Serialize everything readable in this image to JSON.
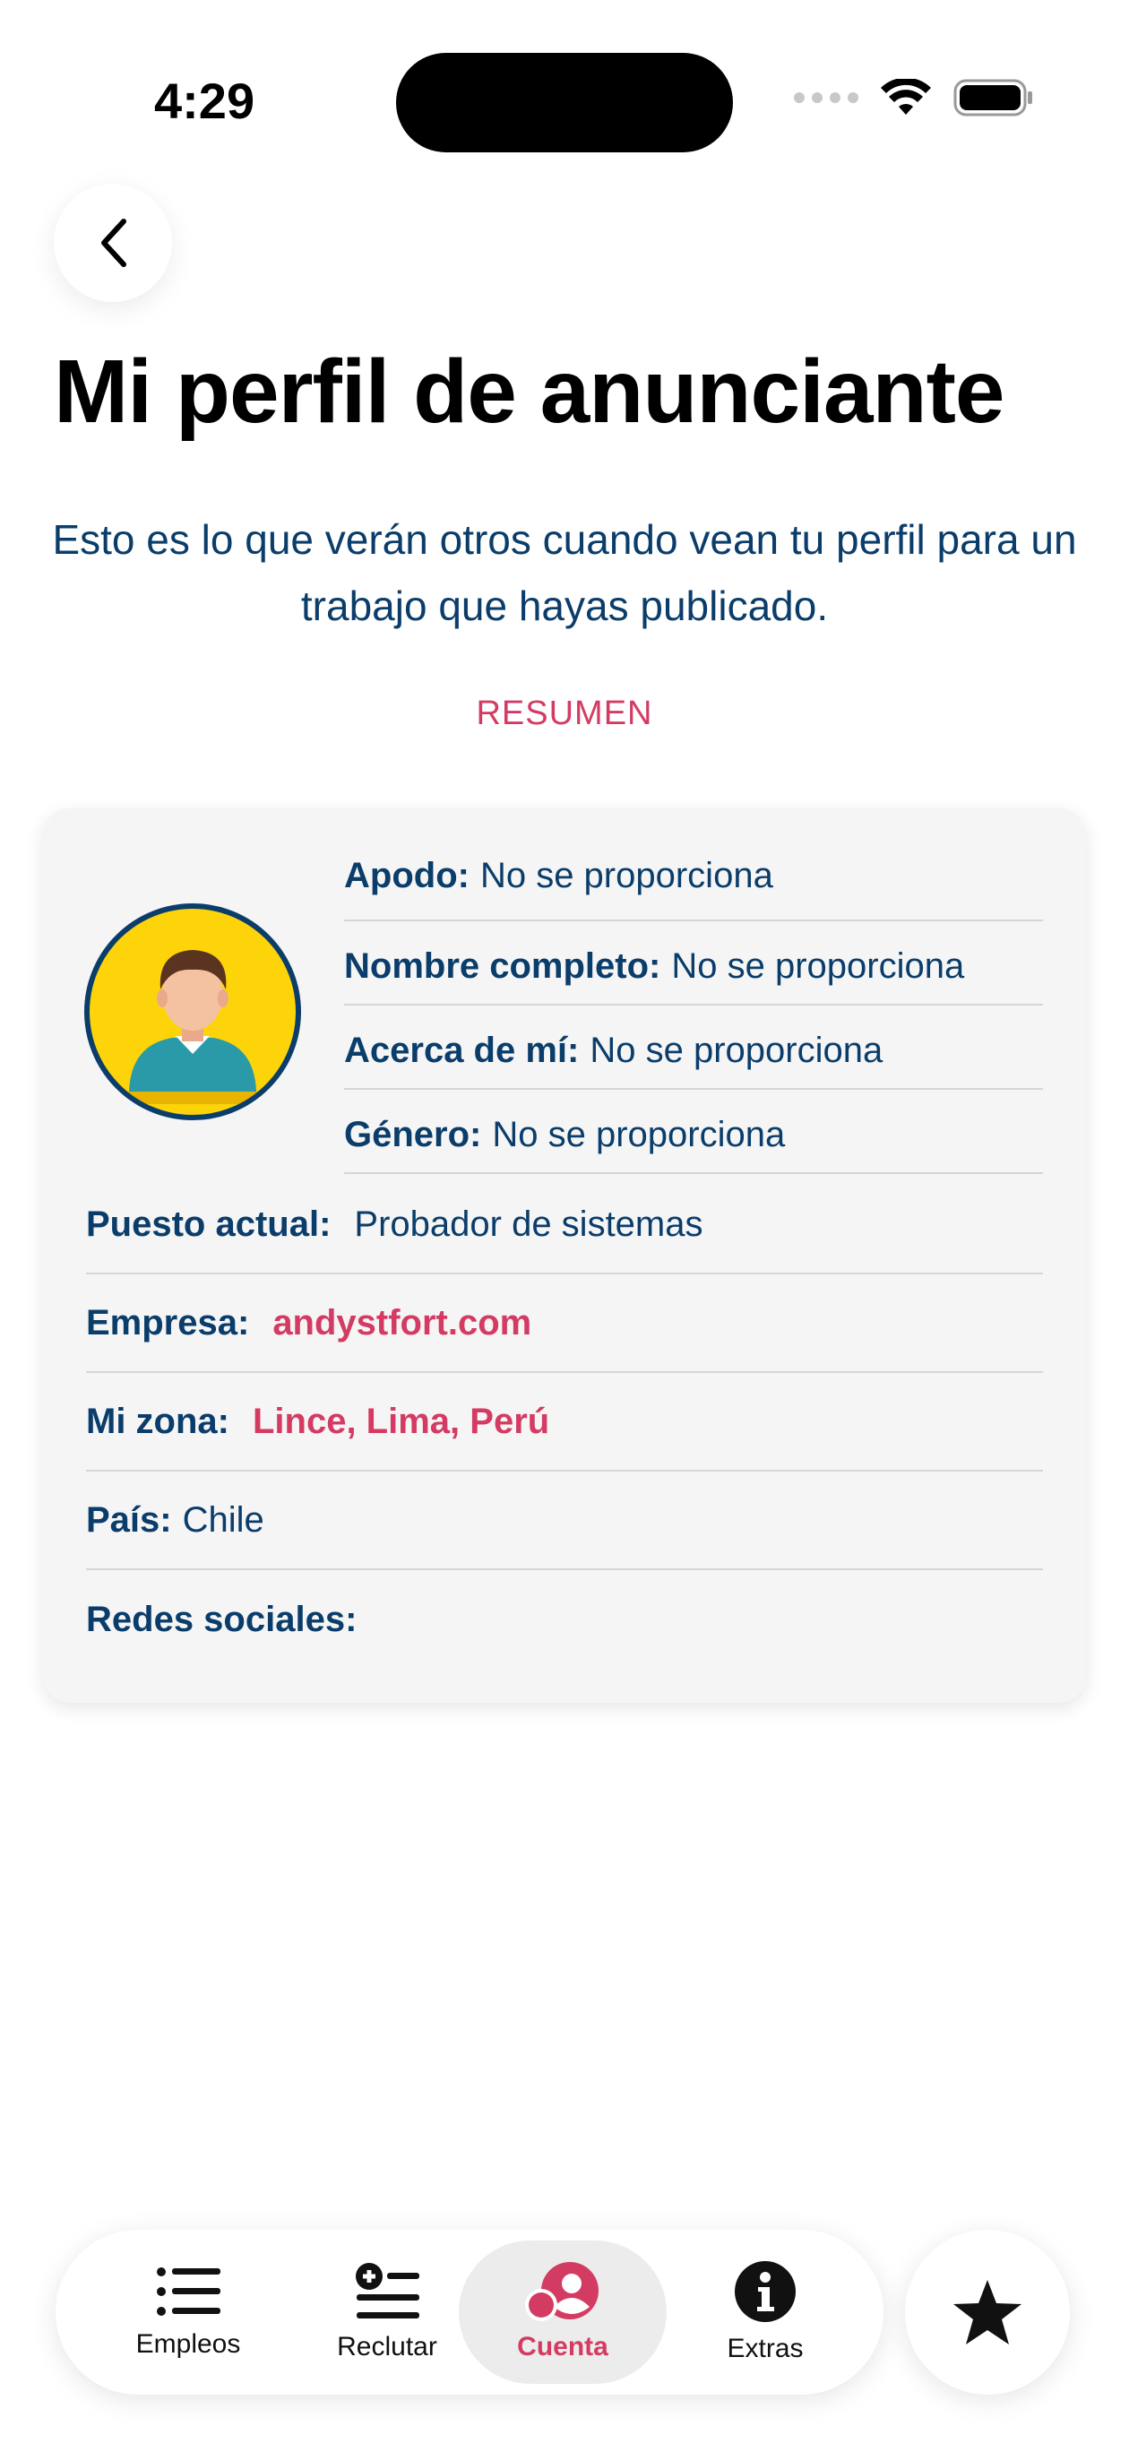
{
  "status_bar": {
    "time": "4:29"
  },
  "header": {
    "title": "Mi perfil de anunciante",
    "subtitle": "Esto es lo que verán otros cuando vean tu perfil para un trabajo que hayas publicado.",
    "section_label": "RESUMEN"
  },
  "profile": {
    "nickname": {
      "label": "Apodo:",
      "value": "No se proporciona"
    },
    "full_name": {
      "label": "Nombre completo:",
      "value": "No se proporciona"
    },
    "about": {
      "label": "Acerca de mí:",
      "value": "No se proporciona"
    },
    "gender": {
      "label": "Género:",
      "value": "No se proporciona"
    },
    "position": {
      "label": "Puesto actual:",
      "value": "Probador de sistemas"
    },
    "company": {
      "label": "Empresa:",
      "value": "andystfort.com"
    },
    "zone": {
      "label": "Mi zona:",
      "value": "Lince, Lima, Perú"
    },
    "country": {
      "label": "País:",
      "value": "Chile"
    },
    "social": {
      "label": "Redes sociales:",
      "value": ""
    }
  },
  "tabbar": {
    "tabs": [
      {
        "label": "Empleos",
        "icon": "list-icon"
      },
      {
        "label": "Reclutar",
        "icon": "add-list-icon"
      },
      {
        "label": "Cuenta",
        "icon": "account-icon",
        "active": true
      },
      {
        "label": "Extras",
        "icon": "info-icon"
      }
    ],
    "favorite_icon": "star-icon"
  },
  "colors": {
    "primary": "#0b3d6b",
    "accent": "#d43b63",
    "card_bg": "#f5f5f5"
  }
}
